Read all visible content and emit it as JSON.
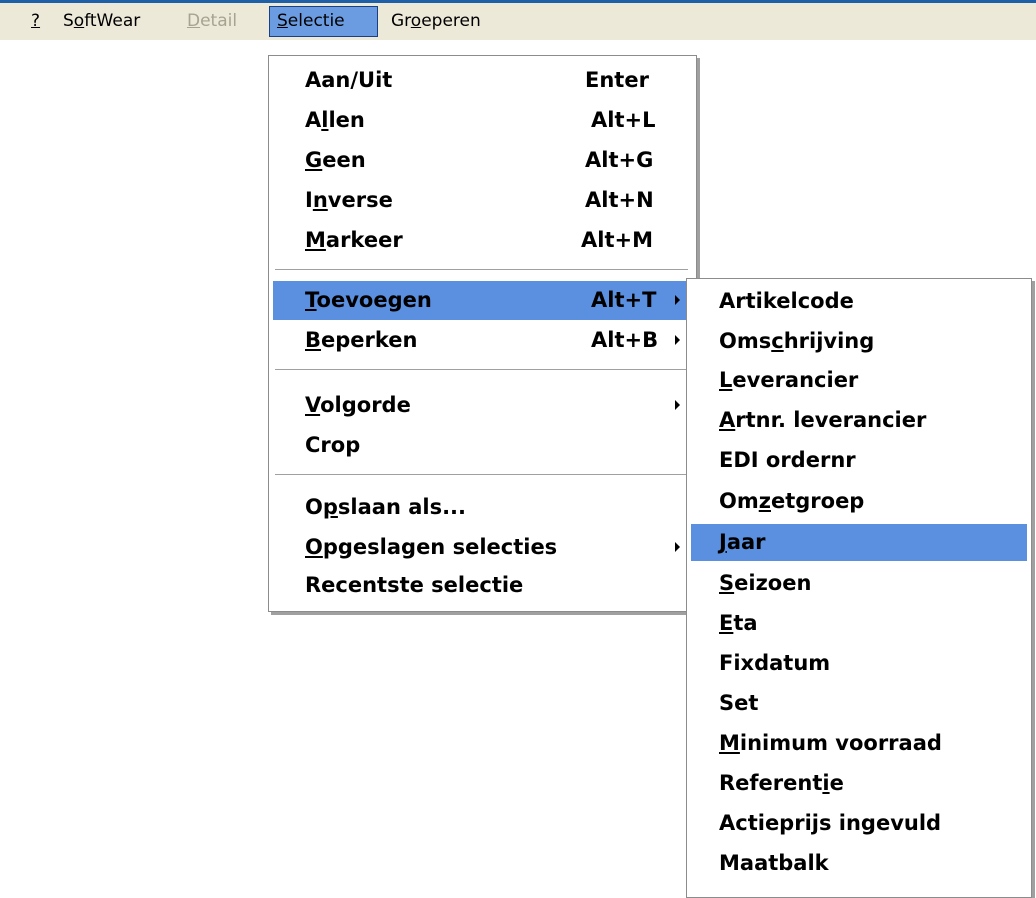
{
  "menubar": {
    "items": [
      {
        "pre": "",
        "ul": "?",
        "post": "",
        "state": "normal"
      },
      {
        "pre": "S",
        "ul": "o",
        "post": "ftWear",
        "state": "normal"
      },
      {
        "pre": "",
        "ul": "D",
        "post": "etail",
        "state": "disabled"
      },
      {
        "pre": "",
        "ul": "S",
        "post": "electie",
        "state": "active"
      },
      {
        "pre": "Gr",
        "ul": "o",
        "post": "eperen",
        "state": "normal"
      }
    ]
  },
  "selectie_menu": {
    "items": [
      {
        "pre": "Aan/Uit",
        "ul": "",
        "post": "",
        "accel": "Enter",
        "submenu": false
      },
      {
        "pre": "A",
        "ul": "l",
        "post": "len",
        "accel": "Alt+L",
        "submenu": false
      },
      {
        "pre": "",
        "ul": "G",
        "post": "een",
        "accel": "Alt+G",
        "submenu": false
      },
      {
        "pre": "I",
        "ul": "n",
        "post": "verse",
        "accel": "Alt+N",
        "submenu": false
      },
      {
        "pre": "",
        "ul": "M",
        "post": "arkeer",
        "accel": "Alt+M",
        "submenu": false
      },
      {
        "pre": "",
        "ul": "T",
        "post": "oevoegen",
        "accel": "Alt+T",
        "submenu": true
      },
      {
        "pre": "",
        "ul": "B",
        "post": "eperken",
        "accel": "Alt+B",
        "submenu": true
      },
      {
        "pre": "",
        "ul": "V",
        "post": "olgorde",
        "accel": "",
        "submenu": true
      },
      {
        "pre": "Crop",
        "ul": "",
        "post": "",
        "accel": "",
        "submenu": false
      },
      {
        "pre": "O",
        "ul": "p",
        "post": "slaan als...",
        "accel": "",
        "submenu": false
      },
      {
        "pre": "",
        "ul": "O",
        "post": "pgeslagen selecties",
        "accel": "",
        "submenu": true
      },
      {
        "pre": "Recentste selectie",
        "ul": "",
        "post": "",
        "accel": "",
        "submenu": false
      }
    ],
    "highlighted_index": 5
  },
  "toevoegen_submenu": {
    "items": [
      {
        "pre": "Artikelcode",
        "ul": "",
        "post": ""
      },
      {
        "pre": "Oms",
        "ul": "c",
        "post": "hrijving"
      },
      {
        "pre": "",
        "ul": "L",
        "post": "everancier"
      },
      {
        "pre": "",
        "ul": "A",
        "post": "rtnr. leverancier"
      },
      {
        "pre": "EDI ordernr",
        "ul": "",
        "post": ""
      },
      {
        "pre": "Om",
        "ul": "z",
        "post": "etgroep"
      },
      {
        "pre": "",
        "ul": "J",
        "post": "aar"
      },
      {
        "pre": "",
        "ul": "S",
        "post": "eizoen"
      },
      {
        "pre": "",
        "ul": "E",
        "post": "ta"
      },
      {
        "pre": "Fixdatum",
        "ul": "",
        "post": ""
      },
      {
        "pre": "Set",
        "ul": "",
        "post": ""
      },
      {
        "pre": "",
        "ul": "M",
        "post": "inimum voorraad"
      },
      {
        "pre": "Referent",
        "ul": "i",
        "post": "e"
      },
      {
        "pre": "Actieprijs ingevuld",
        "ul": "",
        "post": ""
      },
      {
        "pre": "Maatbalk",
        "ul": "",
        "post": ""
      }
    ],
    "highlighted_index": 6
  }
}
